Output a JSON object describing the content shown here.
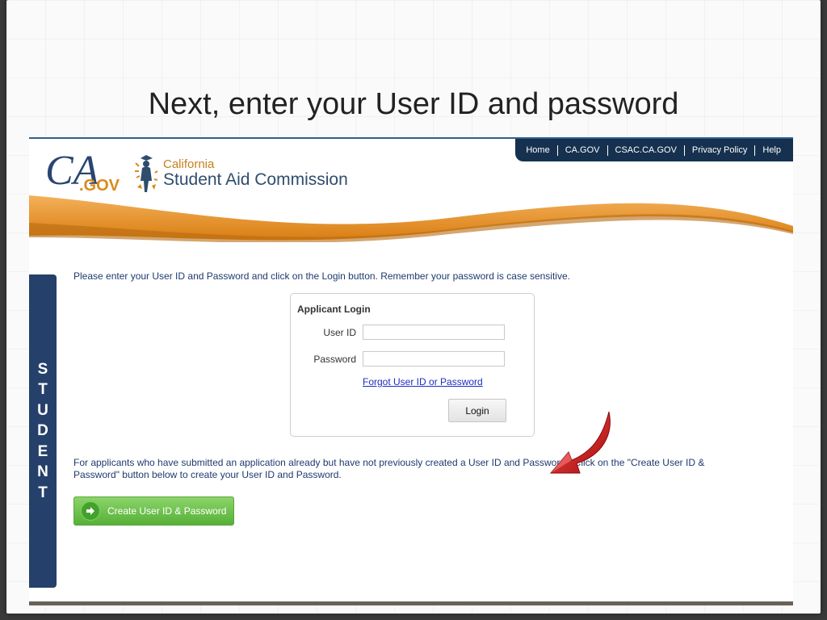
{
  "slide": {
    "title": "Next, enter your User ID and password"
  },
  "header": {
    "ca_logo_main": "CA",
    "ca_logo_suffix": ".GOV",
    "csac_line1": "California",
    "csac_line2": "Student Aid Commission",
    "nav": [
      "Home",
      "CA.GOV",
      "CSAC.CA.GOV",
      "Privacy Policy",
      "Help"
    ],
    "colors": {
      "nav_bg": "#15314f",
      "swoosh": "#e08a1e",
      "logo_orange": "#c77f1c"
    }
  },
  "side_tab": {
    "text": "STUDENT",
    "color": "#25406a"
  },
  "main": {
    "instructions": "Please enter your User ID and Password and click on the Login button. Remember your password is case sensitive.",
    "login": {
      "title": "Applicant Login",
      "user_label": "User ID",
      "user_value": "",
      "password_label": "Password",
      "password_value": "",
      "forgot_link": "Forgot User ID or Password",
      "login_button": "Login"
    },
    "applicants_note": "For applicants who have submitted an application already but have not previously created a User ID and Password - Click on the \"Create User ID & Password\" button below to create your User ID and Password.",
    "create_button": "Create User ID & Password",
    "create_button_icon": "arrow-right-icon",
    "annotation_icon": "red-arrow-icon"
  }
}
